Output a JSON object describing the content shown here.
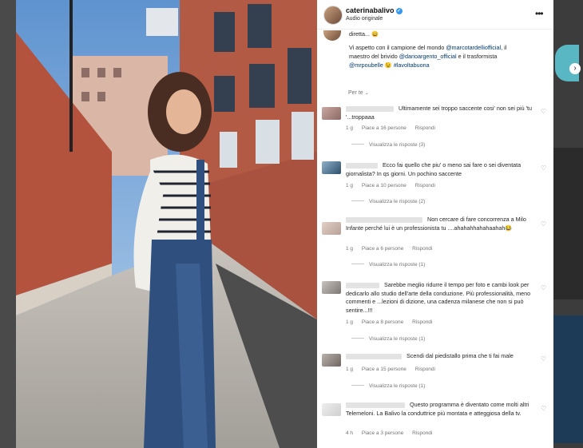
{
  "post": {
    "username": "caterinabalivo",
    "audio": "Audio originale",
    "caption_lines": [
      "diretta... 😄",
      "Vi aspetto con il campione del mondo @marcotardelliofficial, il",
      "maestro del brivido @darioargento_official e il trasformista",
      "@mrpoubelle 😉 #lavoltabuona"
    ],
    "sort_label": "Per te"
  },
  "comments": [
    {
      "text": "Ultimamente sei troppo saccente cosi' non sei più 'tu '...troppaaa",
      "meta": [
        "1 g",
        "Piace a 16 persone",
        "Rispondi"
      ],
      "replies": "Visualizza le risposte (3)"
    },
    {
      "text": "Ecco fai quello che piu' o meno sai fare o sei diventata giornalista? In qs giorni. Un pochino saccente",
      "meta": [
        "1 g",
        "Piace a 10 persone",
        "Rispondi"
      ],
      "replies": "Visualizza le risposte (2)"
    },
    {
      "text": "Non cercare di fare concorrenza a Milo Infante perché lui è un professionista tu ....ahahahhahahaahah😂",
      "meta": [
        "1 g",
        "Piace a 6 persone",
        "Rispondi"
      ],
      "replies": "Visualizza le risposte (1)"
    },
    {
      "text": "Sarebbe meglio ridurre il tempo per foto e cambi look per dedicarlo allo studio dell'arte della conduzione. Più professionalità, meno commenti e ...lezioni di dizione, una cadenza milanese che non si può sentire...!!!",
      "meta": [
        "1 g",
        "Piace a 8 persone",
        "Rispondi"
      ],
      "replies": "Visualizza le risposte (1)"
    },
    {
      "text": "Scendi dal piedistallo prima che ti fai male",
      "meta": [
        "1 g",
        "Piace a 15 persone",
        "Rispondi"
      ],
      "replies": "Visualizza le risposte (1)"
    },
    {
      "text": "Questo programma è diventato come molti altri Telemeloni. La Balivo la conduttrice più montata e atteggiosa della tv.",
      "meta": [
        "4 h",
        "Piace a 3 persone",
        "Rispondi"
      ],
      "replies": ""
    }
  ],
  "colors": {
    "link": "#00376b",
    "muted": "#737373",
    "verified": "#3797f0"
  }
}
